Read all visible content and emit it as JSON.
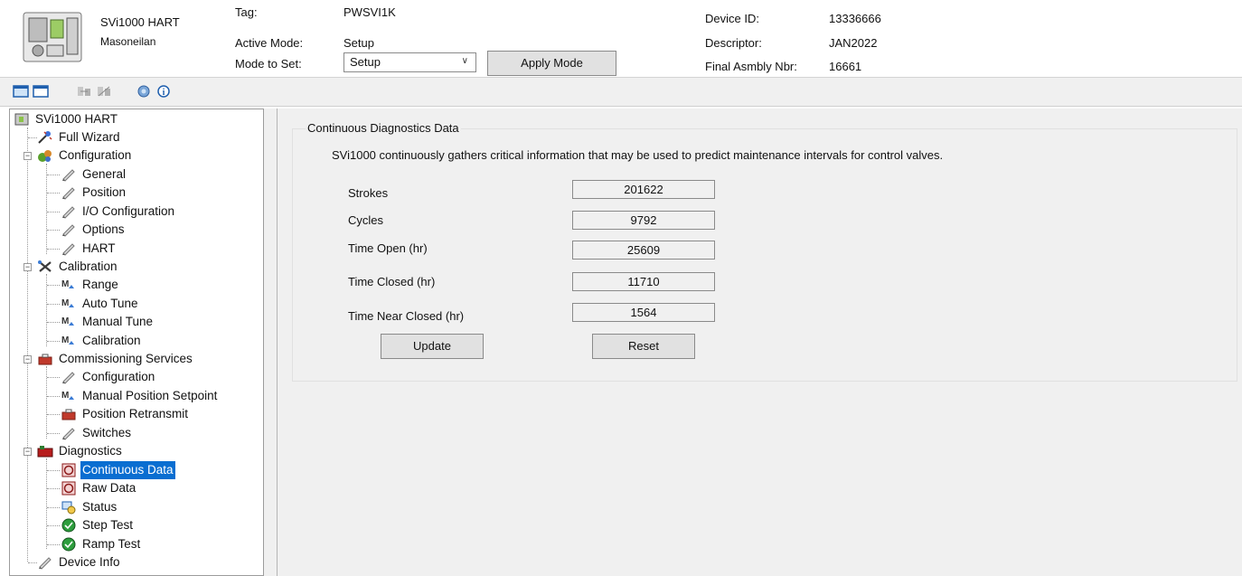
{
  "header": {
    "device_name": "SVi1000 HART",
    "manufacturer": "Masoneilan",
    "tag_label": "Tag:",
    "tag_value": "PWSVI1K",
    "active_mode_label": "Active Mode:",
    "active_mode_value": "Setup",
    "mode_to_set_label": "Mode to Set:",
    "mode_to_set_value": "Setup",
    "apply_mode_label": "Apply Mode",
    "device_id_label": "Device ID:",
    "device_id_value": "13336666",
    "descriptor_label": "Descriptor:",
    "descriptor_value": "JAN2022",
    "final_asmbly_label": "Final Asmbly Nbr:",
    "final_asmbly_value": "16661"
  },
  "toolbar": {
    "icons": [
      "panel-view-icon",
      "panel-view-alt-icon",
      "connect-icon",
      "disconnect-icon",
      "help-icon",
      "info-icon"
    ]
  },
  "tree": {
    "root": "SVi1000 HART",
    "full_wizard": "Full Wizard",
    "configuration": "Configuration",
    "config_items": [
      "General",
      "Position",
      "I/O Configuration",
      "Options",
      "HART"
    ],
    "calibration": "Calibration",
    "calib_items": [
      "Range",
      "Auto Tune",
      "Manual Tune",
      "Calibration"
    ],
    "commissioning": "Commissioning Services",
    "comm_items": [
      "Configuration",
      "Manual Position Setpoint",
      "Position Retransmit",
      "Switches"
    ],
    "diagnostics": "Diagnostics",
    "diag_items": [
      "Continuous Data",
      "Raw Data",
      "Status",
      "Step Test",
      "Ramp Test"
    ],
    "device_info": "Device Info",
    "selected": "Continuous Data"
  },
  "main": {
    "group_title": "Continuous Diagnostics Data",
    "description": "SVi1000 continuously gathers critical information that may be used to predict maintenance intervals for control valves.",
    "fields": [
      {
        "label": "Strokes",
        "value": "201622"
      },
      {
        "label": "Cycles",
        "value": "9792"
      },
      {
        "label": "Time Open (hr)",
        "value": "25609"
      },
      {
        "label": "Time Closed (hr)",
        "value": "11710"
      },
      {
        "label": "Time Near Closed (hr)",
        "value": "1564"
      }
    ],
    "update_label": "Update",
    "reset_label": "Reset"
  },
  "colors": {
    "selection": "#0a6ed1",
    "panel_bg": "#f0f0f0",
    "button_bg": "#e1e1e1"
  }
}
